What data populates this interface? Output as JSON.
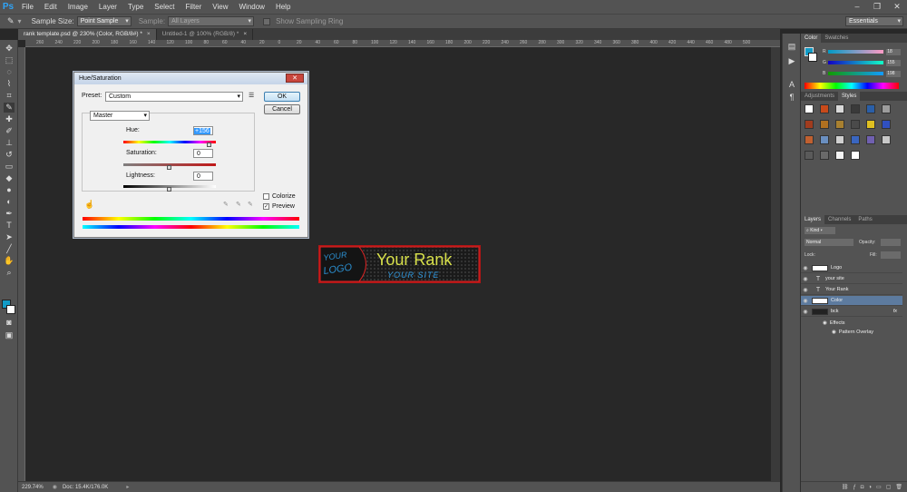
{
  "app": {
    "logo": "Ps",
    "menu": [
      "File",
      "Edit",
      "Image",
      "Layer",
      "Type",
      "Select",
      "Filter",
      "View",
      "Window",
      "Help"
    ]
  },
  "options_bar": {
    "sample_size_label": "Sample Size:",
    "sample_size_value": "Point Sample",
    "sample_label": "Sample:",
    "sample_value": "All Layers",
    "show_ring_label": "Show Sampling Ring",
    "workspace": "Essentials"
  },
  "tabs": [
    {
      "label": "rank template.psd @ 230% (Color, RGB/8#) *",
      "close": "×"
    },
    {
      "label": "Untitled-1 @ 100% (RGB/8) *",
      "close": "×"
    }
  ],
  "ruler_labels": [
    "260",
    "240",
    "220",
    "200",
    "180",
    "160",
    "140",
    "120",
    "100",
    "80",
    "60",
    "40",
    "20",
    "0",
    "20",
    "40",
    "60",
    "80",
    "100",
    "120",
    "140",
    "160",
    "180",
    "200",
    "220",
    "240",
    "260",
    "280",
    "300",
    "320",
    "340",
    "360",
    "380",
    "400",
    "420",
    "440",
    "460",
    "480",
    "500",
    "520"
  ],
  "status": {
    "zoom": "229.74%",
    "doc": "Doc: 15.4K/176.0K"
  },
  "dialog": {
    "title": "Hue/Saturation",
    "close": "✕",
    "preset_label": "Preset:",
    "preset_value": "Custom",
    "ok": "OK",
    "cancel": "Cancel",
    "channel": "Master",
    "hue_label": "Hue:",
    "hue_value": "+156",
    "saturation_label": "Saturation:",
    "saturation_value": "0",
    "lightness_label": "Lightness:",
    "lightness_value": "0",
    "colorize_label": "Colorize",
    "preview_label": "Preview",
    "preview_checked": "✓",
    "hue_position": 0.93,
    "saturation_position": 0.5,
    "lightness_position": 0.5
  },
  "banner": {
    "logo_line1": "YOUR",
    "logo_line2": "LOGO",
    "title": "Your Rank",
    "subtitle": "YOUR SITE"
  },
  "color_panel": {
    "tabs": [
      "Color",
      "Swatches"
    ],
    "r_label": "R",
    "r_value": "18",
    "g_label": "G",
    "g_value": "155",
    "b_label": "B",
    "b_value": "198"
  },
  "styles_panel": {
    "tabs": [
      "Adjustments",
      "Styles"
    ]
  },
  "layers_panel": {
    "tabs": [
      "Layers",
      "Channels",
      "Paths"
    ],
    "kind": "Kind",
    "blend_mode": "Normal",
    "opacity_label": "Opacity:",
    "lock_label": "Lock:",
    "fill_label": "Fill:",
    "layers": [
      {
        "name": "Logo",
        "type": "thumb"
      },
      {
        "name": "your site",
        "type": "text",
        "glyph": "T"
      },
      {
        "name": "Your Rank",
        "type": "text",
        "glyph": "T"
      },
      {
        "name": "Color",
        "type": "thumb",
        "selected": true
      },
      {
        "name": "bck",
        "type": "thumb",
        "fx": "fx"
      }
    ],
    "effects_label": "Effects",
    "pattern_overlay_label": "Pattern Overlay"
  },
  "colors": {
    "foreground": "#129bc6",
    "background": "#ffffff",
    "accent_selected": "#5d7b9f"
  }
}
